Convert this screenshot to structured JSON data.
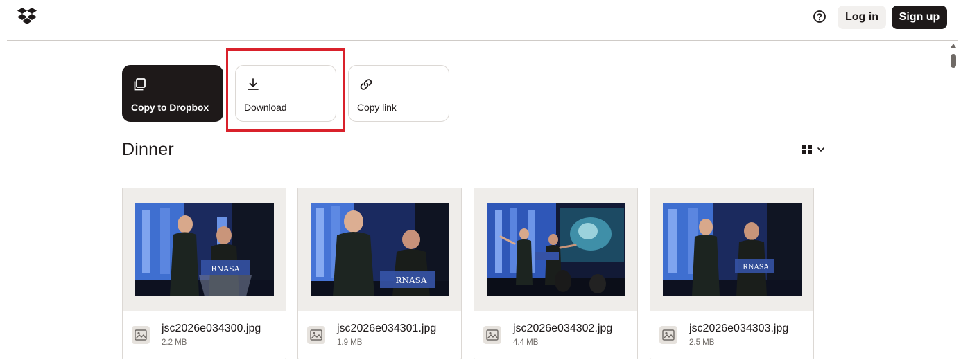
{
  "header": {
    "logo_icon": "dropbox-logo-icon",
    "help_icon": "question-circle-icon",
    "login_label": "Log in",
    "signup_label": "Sign up"
  },
  "actions": [
    {
      "label": "Copy to Dropbox",
      "icon": "copy-icon"
    },
    {
      "label": "Download",
      "icon": "download-icon"
    },
    {
      "label": "Copy link",
      "icon": "link-icon"
    }
  ],
  "folder": {
    "title": "Dinner",
    "view_icon": "grid-view-icon"
  },
  "files": [
    {
      "name": "jsc2026e034300.jpg",
      "size": "2.2 MB"
    },
    {
      "name": "jsc2026e034301.jpg",
      "size": "1.9 MB"
    },
    {
      "name": "jsc2026e034302.jpg",
      "size": "4.4 MB"
    },
    {
      "name": "jsc2026e034303.jpg",
      "size": "2.5 MB"
    }
  ],
  "colors": {
    "brand_dark": "#1e1919",
    "highlight": "#d9212b",
    "stage_blue": "#2f57b8"
  }
}
